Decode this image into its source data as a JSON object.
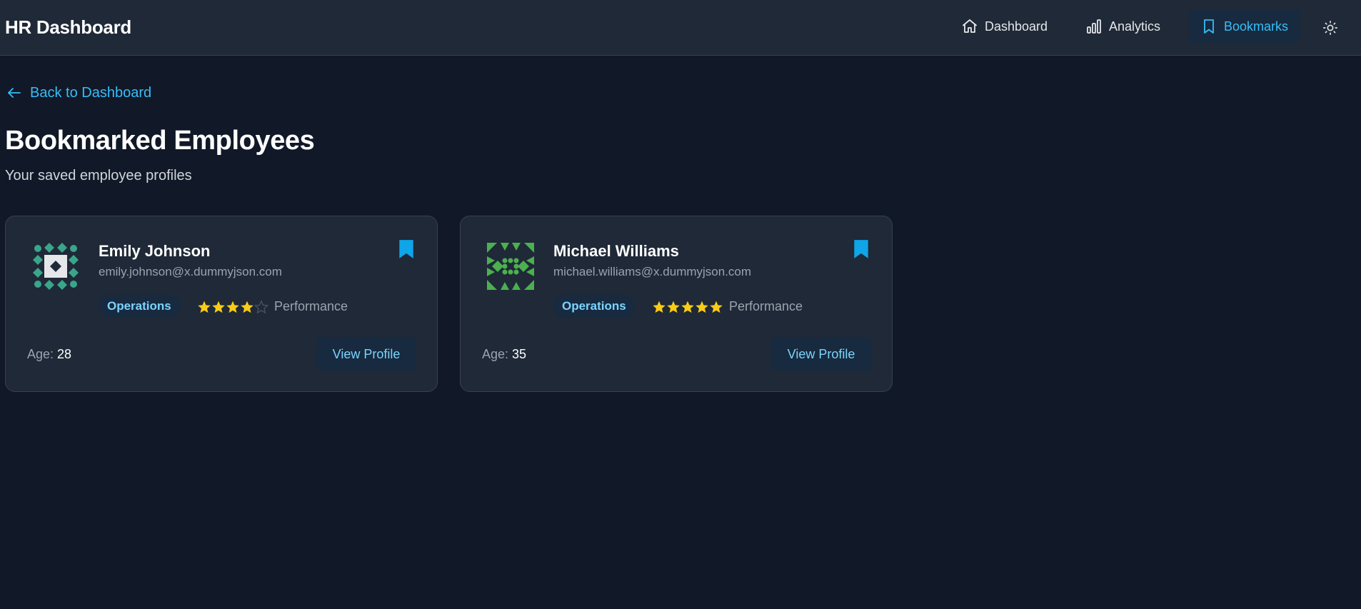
{
  "app": {
    "title": "HR Dashboard"
  },
  "nav": {
    "items": [
      {
        "label": "Dashboard",
        "icon": "home-icon"
      },
      {
        "label": "Analytics",
        "icon": "bar-chart-icon"
      },
      {
        "label": "Bookmarks",
        "icon": "bookmark-icon",
        "active": true
      }
    ],
    "theme_toggle_icon": "sun-icon"
  },
  "back_link": {
    "label": "Back to Dashboard",
    "icon": "arrow-left-icon"
  },
  "page": {
    "title": "Bookmarked Employees",
    "subtitle": "Your saved employee profiles"
  },
  "employees": [
    {
      "name": "Emily Johnson",
      "email": "emily.johnson@x.dummyjson.com",
      "department": "Operations",
      "rating": 4,
      "rating_max": 5,
      "performance_label": "Performance",
      "age_label": "Age:",
      "age": "28",
      "action_label": "View Profile",
      "bookmarked": true,
      "avatar_color": "#3aa58a"
    },
    {
      "name": "Michael Williams",
      "email": "michael.williams@x.dummyjson.com",
      "department": "Operations",
      "rating": 5,
      "rating_max": 5,
      "performance_label": "Performance",
      "age_label": "Age:",
      "age": "35",
      "action_label": "View Profile",
      "bookmarked": true,
      "avatar_color": "#4caf50"
    }
  ],
  "colors": {
    "accent": "#38bdf8",
    "background": "#111827",
    "card": "#1f2937",
    "star": "#facc15",
    "star_empty": "#4b5563"
  }
}
